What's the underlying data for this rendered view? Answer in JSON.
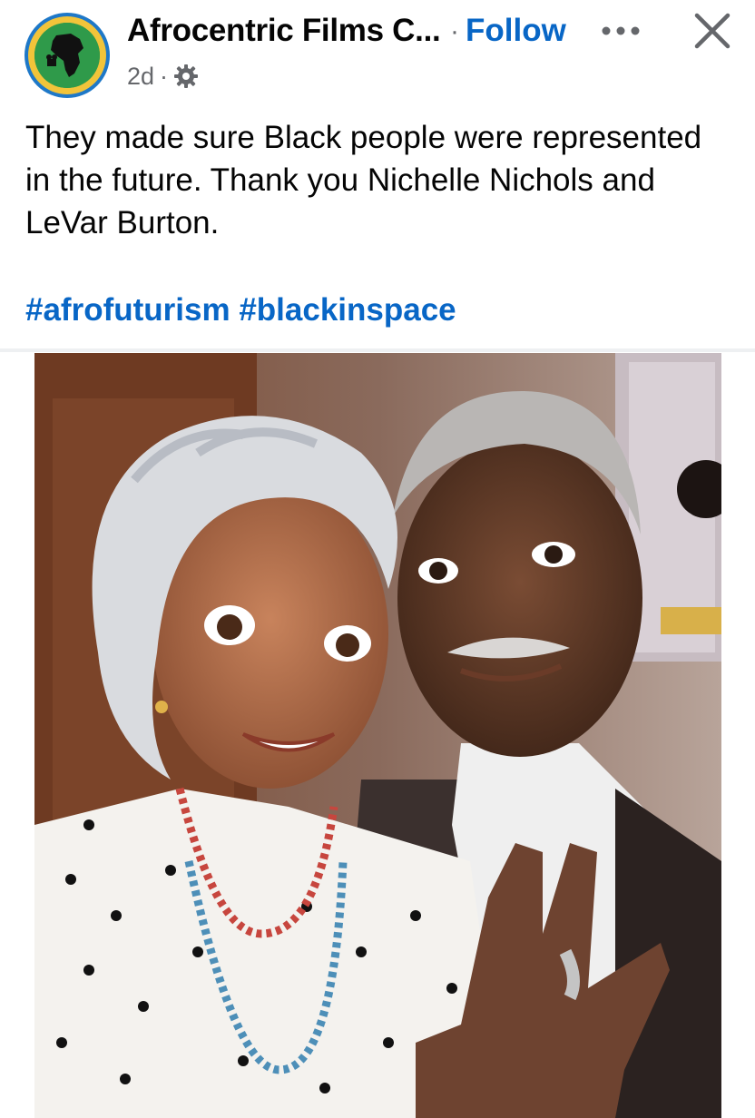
{
  "header": {
    "page_name": "Afrocentric Films C...",
    "separator": "·",
    "follow_label": "Follow",
    "time": "2d",
    "meta_separator": "·",
    "icons": {
      "avatar": "page-logo",
      "more": "more-horizontal-icon",
      "close": "close-icon",
      "privacy": "gear-icon"
    }
  },
  "post": {
    "text_lines": [
      "They made sure Black people were represented",
      "in the future.  Thank you Nichelle Nichols and",
      "LeVar Burton."
    ],
    "hashtags": [
      "#afrofuturism",
      "#blackinspace"
    ]
  },
  "colors": {
    "link": "#0866c6",
    "text": "#050505",
    "secondary": "#65676b",
    "avatar_ring": "#1e78c8",
    "avatar_gold": "#f2c43a",
    "avatar_fill": "#2f9a4a"
  }
}
